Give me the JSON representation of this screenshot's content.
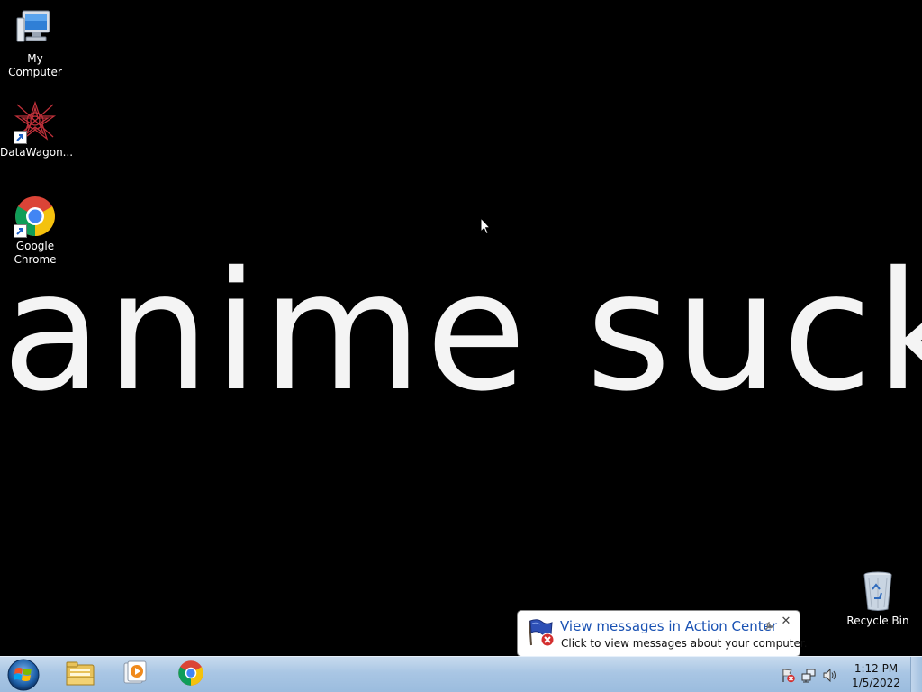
{
  "desktop": {
    "wallpaper_text": "anime sucks",
    "icons": [
      {
        "label": "My Computer",
        "icon": "computer-icon"
      },
      {
        "label": "DataWagon...",
        "icon": "datawagon-icon"
      },
      {
        "label": "Google Chrome",
        "icon": "chrome-icon"
      },
      {
        "label": "Recycle Bin",
        "icon": "recycle-bin-icon"
      }
    ]
  },
  "notification": {
    "title": "View messages in Action Center",
    "body": "Click to view messages about your computer.",
    "close_glyph": "✕",
    "icon": "action-center-flag-icon"
  },
  "taskbar": {
    "start_icon": "windows-start-icon",
    "pinned": [
      {
        "name": "Windows Explorer",
        "icon": "folder-icon"
      },
      {
        "name": "Windows Media Player",
        "icon": "media-player-icon"
      },
      {
        "name": "Google Chrome",
        "icon": "chrome-icon"
      }
    ],
    "tray": [
      "action-center-flag-icon",
      "network-icon",
      "volume-icon"
    ],
    "clock": {
      "time": "1:12 PM",
      "date": "1/5/2022"
    }
  },
  "colors": {
    "desktop_bg": "#000000",
    "taskbar": "#a9c6e4",
    "balloon_title": "#1a52b3"
  }
}
